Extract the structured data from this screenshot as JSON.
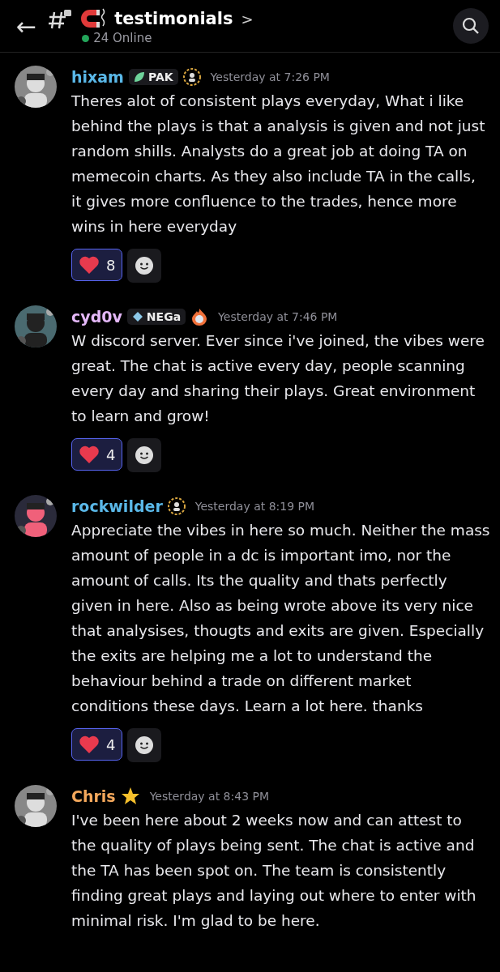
{
  "header": {
    "back": "←",
    "channel": "testimonials",
    "chevron": ">",
    "online": "24 Online"
  },
  "messages": [
    {
      "author": "hixam",
      "color": "#5ab8e8",
      "tag": {
        "kind": "leaf",
        "label": "PAK"
      },
      "badge": {
        "kind": "laurel"
      },
      "time": "Yesterday at 7:26 PM",
      "text": "Theres alot of consistent plays everyday, What i like behind the plays is that a analysis is given and not just random shills. Analysts do a great job at doing TA on memecoin charts. As they also include TA in the calls, it gives more confluence to the trades, hence more wins in here everyday",
      "reaction": {
        "count": "8",
        "selected": true
      }
    },
    {
      "author": "cyd0v",
      "color": "#e4b8f8",
      "tag": {
        "kind": "gem",
        "label": "NEGa"
      },
      "badge": {
        "kind": "fire"
      },
      "time": "Yesterday at 7:46 PM",
      "text": "W discord server. Ever since i've joined, the vibes were great. The chat is active every day, people scanning every day and sharing their plays. Great environment to learn and grow!",
      "reaction": {
        "count": "4",
        "selected": true
      }
    },
    {
      "author": "rockwilder",
      "color": "#5ab8e8",
      "badge": {
        "kind": "laurel"
      },
      "time": "Yesterday at 8:19 PM",
      "text": "Appreciate the vibes in here so much. Neither the mass amount of people in a dc is important imo, nor the amount of calls. Its the quality and thats perfectly given in here. Also as being wrote above its very nice that analysises, thougts and exits are given. Especially the exits are helping me a lot to understand the behaviour behind a trade on different market conditions these days. Learn a lot here. thanks",
      "reaction": {
        "count": "4",
        "selected": true
      }
    },
    {
      "author": "Chris",
      "color": "#f4a85c",
      "badge": {
        "kind": "star"
      },
      "time": "Yesterday at 8:43 PM",
      "text": "I've been here about 2 weeks now and can attest to the quality of plays being sent. The chat is active and the TA has been spot on. The team is consistently finding great plays and laying out where to enter with minimal risk. I'm glad to be here."
    }
  ]
}
